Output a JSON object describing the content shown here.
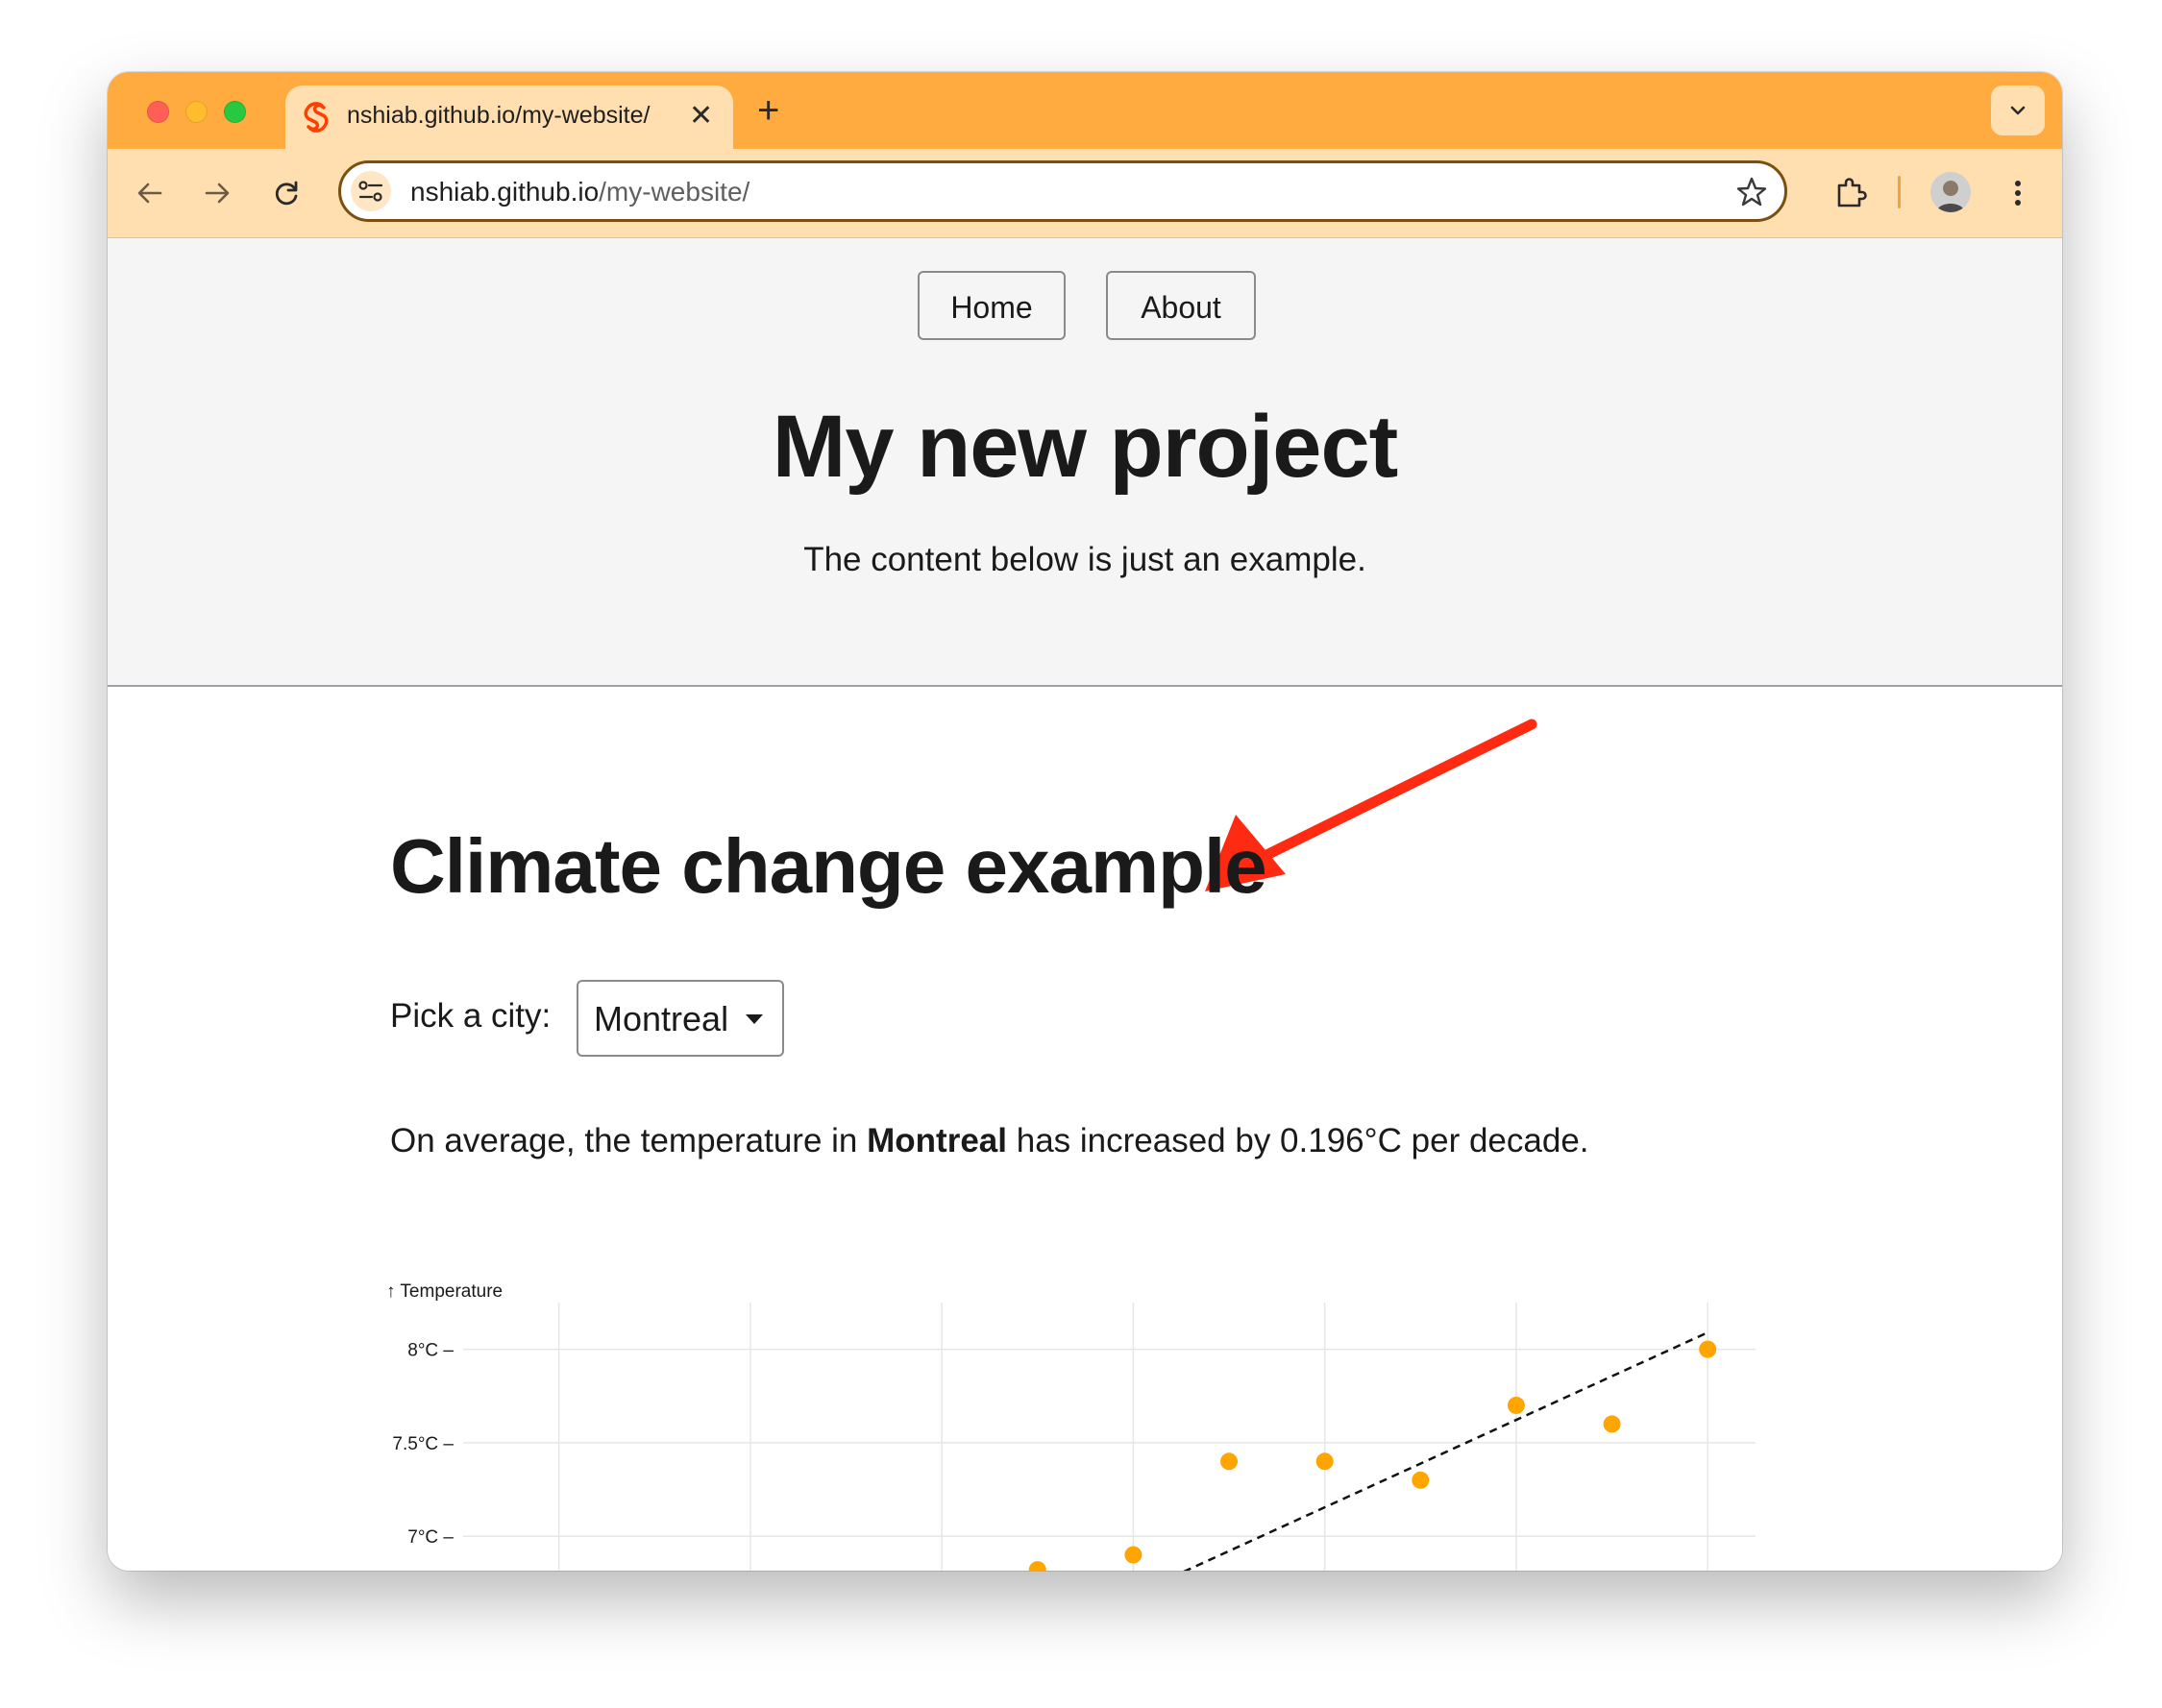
{
  "browser": {
    "tab_title": "nshiab.github.io/my-website/",
    "tab_close": "✕",
    "new_tab": "+",
    "url_host": "nshiab.github.io",
    "url_path": "/my-website/"
  },
  "nav": {
    "home": "Home",
    "about": "About"
  },
  "header": {
    "title": "My new project",
    "subtitle": "The content below is just an example."
  },
  "section": {
    "title": "Climate change example",
    "pick_label": "Pick a city:",
    "selected_city": "Montreal",
    "summary_prefix": "On average, the temperature in",
    "summary_city": "Montreal",
    "summary_suffix": "has increased by 0.196°C per decade."
  },
  "colors": {
    "accent": "#ffab40",
    "point": "#ffa500",
    "annotation_arrow": "#ff2a12"
  },
  "chart_data": {
    "type": "scatter",
    "ylabel": "↑ Temperature",
    "y_ticks": [
      {
        "value": 8,
        "label": "8°C –"
      },
      {
        "value": 7.5,
        "label": "7.5°C –"
      },
      {
        "value": 7,
        "label": "7°C –"
      }
    ],
    "ylim": [
      6.8,
      8.25
    ],
    "x_range": [
      0,
      13.5
    ],
    "x_grid": [
      1,
      3,
      5,
      7,
      9,
      11,
      13
    ],
    "grid": true,
    "points": [
      {
        "x": 6,
        "y": 6.82
      },
      {
        "x": 7,
        "y": 6.9
      },
      {
        "x": 8,
        "y": 7.4
      },
      {
        "x": 9,
        "y": 7.4
      },
      {
        "x": 10,
        "y": 7.3
      },
      {
        "x": 11,
        "y": 7.7
      },
      {
        "x": 12,
        "y": 7.6
      },
      {
        "x": 13,
        "y": 8.0
      }
    ],
    "trend": {
      "x0": 7.4,
      "y0": 6.78,
      "x1": 13,
      "y1": 8.09,
      "style": "dashed"
    }
  }
}
